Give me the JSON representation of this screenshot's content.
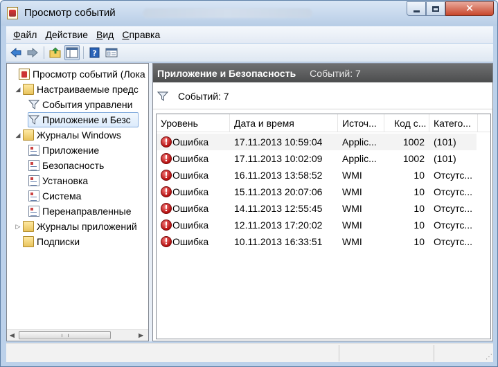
{
  "window": {
    "title": "Просмотр событий",
    "close_glyph": "✕"
  },
  "menu": [
    {
      "underline": "Ф",
      "rest": "айл"
    },
    {
      "underline": "Д",
      "rest": "ействие"
    },
    {
      "underline": "В",
      "rest": "ид"
    },
    {
      "underline": "С",
      "rest": "правка"
    }
  ],
  "toolbar": {
    "buttons": [
      "back-icon",
      "forward-icon",
      "up-folder-icon",
      "show-hide-tree-icon",
      "help-icon",
      "properties-icon"
    ]
  },
  "tree": {
    "items": [
      {
        "label": "Просмотр событий (Лока",
        "icon": "event-viewer-icon",
        "expander": ""
      },
      {
        "label": "Настраиваемые предс",
        "icon": "folder-icon",
        "expander": "◢"
      },
      {
        "label": "События управлени",
        "icon": "filter-icon",
        "expander": ""
      },
      {
        "label": "Приложение и Безс",
        "icon": "filter-icon",
        "expander": "",
        "selected": true
      },
      {
        "label": "Журналы Windows",
        "icon": "folder-icon",
        "expander": "◢"
      },
      {
        "label": "Приложение",
        "icon": "log-icon",
        "expander": ""
      },
      {
        "label": "Безопасность",
        "icon": "log-icon",
        "expander": ""
      },
      {
        "label": "Установка",
        "icon": "log-icon",
        "expander": ""
      },
      {
        "label": "Система",
        "icon": "log-icon",
        "expander": ""
      },
      {
        "label": "Перенаправленные",
        "icon": "log-icon",
        "expander": ""
      },
      {
        "label": "Журналы приложений",
        "icon": "folder-icon",
        "expander": "▷"
      },
      {
        "label": "Подписки",
        "icon": "subscriptions-icon",
        "expander": ""
      }
    ],
    "scroll_left": "◀",
    "scroll_right": "▶"
  },
  "right_pane": {
    "header_title": "Приложение и Безопасность",
    "header_count": "Событий: 7",
    "filter_count": "Событий: 7"
  },
  "table": {
    "columns": [
      "Уровень",
      "Дата и время",
      "Источ...",
      "Код с...",
      "Катего..."
    ],
    "rows": [
      {
        "level": "Ошибка",
        "datetime": "17.11.2013 10:59:04",
        "source": "Applic...",
        "code": "1002",
        "category": "(101)"
      },
      {
        "level": "Ошибка",
        "datetime": "17.11.2013 10:02:09",
        "source": "Applic...",
        "code": "1002",
        "category": "(101)"
      },
      {
        "level": "Ошибка",
        "datetime": "16.11.2013 13:58:52",
        "source": "WMI",
        "code": "10",
        "category": "Отсутс..."
      },
      {
        "level": "Ошибка",
        "datetime": "15.11.2013 20:07:06",
        "source": "WMI",
        "code": "10",
        "category": "Отсутс..."
      },
      {
        "level": "Ошибка",
        "datetime": "14.11.2013 12:55:45",
        "source": "WMI",
        "code": "10",
        "category": "Отсутс..."
      },
      {
        "level": "Ошибка",
        "datetime": "12.11.2013 17:20:02",
        "source": "WMI",
        "code": "10",
        "category": "Отсутс..."
      },
      {
        "level": "Ошибка",
        "datetime": "10.11.2013 16:33:51",
        "source": "WMI",
        "code": "10",
        "category": "Отсутс..."
      }
    ],
    "error_glyph": "!"
  },
  "status_bar": {
    "grip": "⋰"
  }
}
